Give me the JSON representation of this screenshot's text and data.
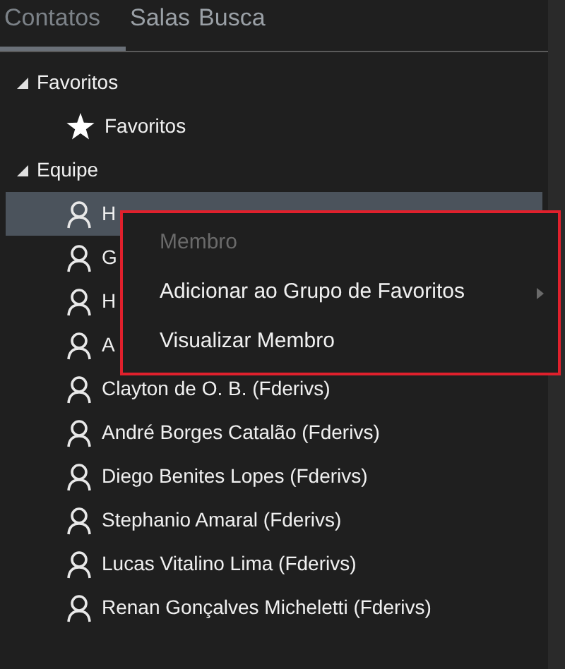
{
  "tabs": [
    {
      "label": "Contatos",
      "selected": true
    },
    {
      "label": "Salas",
      "selected": false
    },
    {
      "label": "Busca",
      "selected": false
    }
  ],
  "groups": [
    {
      "label": "Favoritos",
      "expanded": true,
      "children": [
        {
          "label": "Favoritos",
          "kind": "favorite",
          "selected": false
        }
      ]
    },
    {
      "label": "Equipe",
      "expanded": true,
      "children": [
        {
          "label": "H",
          "kind": "member",
          "selected": true
        },
        {
          "label": "G",
          "kind": "member",
          "selected": false
        },
        {
          "label": "H",
          "kind": "member",
          "selected": false
        },
        {
          "label": "A",
          "kind": "member",
          "selected": false
        },
        {
          "label": "Clayton de O. B. (Fderivs)",
          "kind": "member",
          "selected": false
        },
        {
          "label": "André Borges Catalão (Fderivs)",
          "kind": "member",
          "selected": false
        },
        {
          "label": "Diego Benites Lopes (Fderivs)",
          "kind": "member",
          "selected": false
        },
        {
          "label": "Stephanio Amaral (Fderivs)",
          "kind": "member",
          "selected": false
        },
        {
          "label": "Lucas Vitalino Lima (Fderivs)",
          "kind": "member",
          "selected": false
        },
        {
          "label": "Renan Gonçalves Micheletti (Fderivs)",
          "kind": "member",
          "selected": false
        }
      ]
    }
  ],
  "context_menu": {
    "items": [
      {
        "label": "Membro",
        "disabled": true,
        "submenu": false
      },
      {
        "label": "Adicionar ao Grupo de Favoritos",
        "disabled": false,
        "submenu": true
      },
      {
        "label": "Visualizar Membro",
        "disabled": false,
        "submenu": false
      }
    ]
  }
}
